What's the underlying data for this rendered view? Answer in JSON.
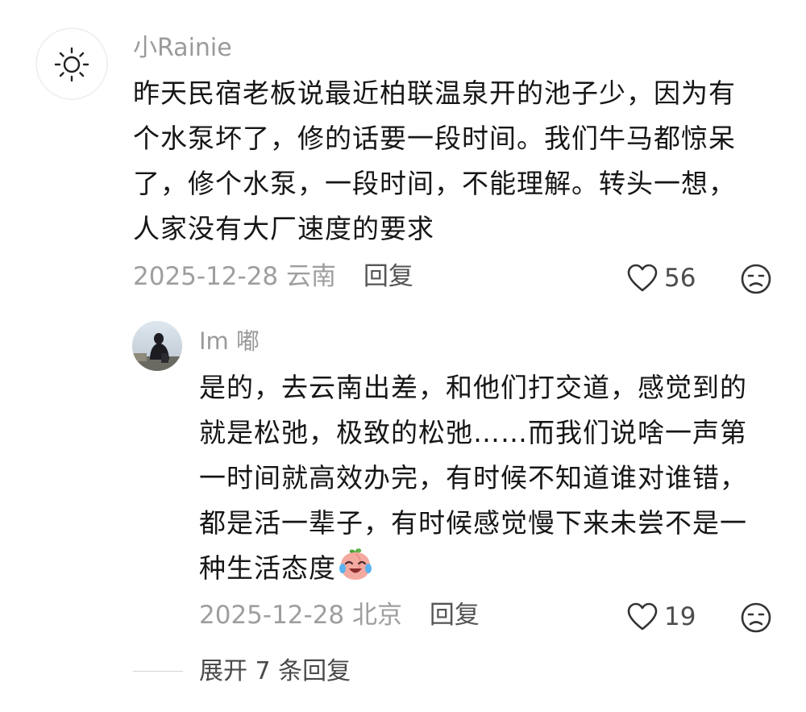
{
  "comment": {
    "username": "小Rainie",
    "avatar_icon": "sun-icon",
    "lines": [
      "昨天民宿老板说最近柏联温泉开的池子少，因为有",
      "个水泵坏了，修的话要一段时间。我们牛马都惊呆",
      "了，修个水泵，一段时间，不能理解。转头一想，",
      "人家没有大厂速度的要求"
    ],
    "date": "2025-12-28",
    "location": "云南",
    "reply_label": "回复",
    "like_count": "56",
    "like_icon": "heart-outline-icon",
    "dislike_icon": "dislike-face-icon"
  },
  "reply": {
    "username": "Im 嘟",
    "avatar_icon": "user-photo-avatar",
    "lines": [
      "是的，去云南出差，和他们打交道，感觉到的",
      "就是松弛，极致的松弛……而我们说啥一声第",
      "一时间就高效办完，有时候不知道谁对谁错，",
      "都是活一辈子，有时候感觉慢下来未尝不是一",
      "种生活态度"
    ],
    "emoji_icon": "crying-laughing-peach-emoji",
    "date": "2025-12-28",
    "location": "北京",
    "reply_label": "回复",
    "like_count": "19",
    "like_icon": "heart-outline-icon",
    "dislike_icon": "dislike-face-icon"
  },
  "expand": {
    "label": "展开 7 条回复"
  },
  "colors": {
    "primary_text": "#161616",
    "secondary_text": "#9e9e9e",
    "username": "#9a9a9a"
  }
}
